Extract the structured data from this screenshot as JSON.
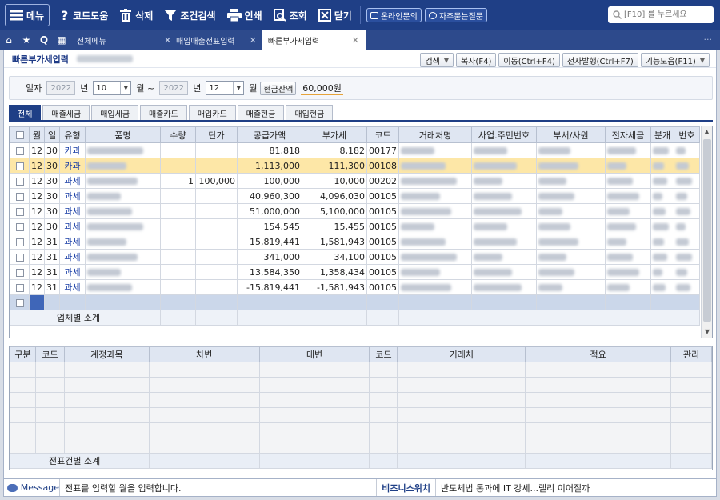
{
  "toolbar": {
    "menu": "메뉴",
    "help": "코드도움",
    "delete": "삭제",
    "filter": "조건검색",
    "print": "인쇄",
    "query": "조회",
    "close": "닫기",
    "online": "온라인문의",
    "faq": "자주묻는질문",
    "search_placeholder": "[F10] 를 누르세요"
  },
  "tabs": {
    "all_menu": "전체메뉴",
    "tab1": "매입매출전표입력",
    "tab2": "빠른부가세입력"
  },
  "page": {
    "title": "빠른부가세입력",
    "buttons": {
      "search": "검색",
      "copy": "복사(F4)",
      "move": "이동(Ctrl+F4)",
      "einvoice": "전자발행(Ctrl+F7)",
      "features": "기능모음(F11)"
    }
  },
  "filter": {
    "date_label": "일자",
    "year_from": "2022",
    "year_unit": "년",
    "month_from": "10",
    "month_unit": "월 ~",
    "year_to": "2022",
    "month_to": "12",
    "month_unit2": "월",
    "cash_button": "현금잔액",
    "cash_value": "60,000원"
  },
  "subtabs": [
    "전체",
    "매출세금",
    "매입세금",
    "매출카드",
    "매입카드",
    "매출현금",
    "매입현금"
  ],
  "grid1": {
    "headers": [
      "",
      "월",
      "일",
      "유형",
      "품명",
      "수량",
      "단가",
      "공급가액",
      "부가세",
      "코드",
      "거래처명",
      "사업.주민번호",
      "부서/사원",
      "전자세금",
      "분개",
      "번호"
    ],
    "rows": [
      {
        "m": "12",
        "d": "30",
        "type": "카과",
        "qty": "",
        "price": "",
        "supply": "81,818",
        "vat": "8,182",
        "code": "00177"
      },
      {
        "m": "12",
        "d": "30",
        "type": "카과",
        "qty": "",
        "price": "",
        "supply": "1,113,000",
        "vat": "111,300",
        "code": "00108"
      },
      {
        "m": "12",
        "d": "30",
        "type": "과세",
        "qty": "1",
        "price": "100,000",
        "supply": "100,000",
        "vat": "10,000",
        "code": "00202"
      },
      {
        "m": "12",
        "d": "30",
        "type": "과세",
        "qty": "",
        "price": "",
        "supply": "40,960,300",
        "vat": "4,096,030",
        "code": "00105"
      },
      {
        "m": "12",
        "d": "30",
        "type": "과세",
        "qty": "",
        "price": "",
        "supply": "51,000,000",
        "vat": "5,100,000",
        "code": "00105"
      },
      {
        "m": "12",
        "d": "30",
        "type": "과세",
        "qty": "",
        "price": "",
        "supply": "154,545",
        "vat": "15,455",
        "code": "00105"
      },
      {
        "m": "12",
        "d": "31",
        "type": "과세",
        "qty": "",
        "price": "",
        "supply": "15,819,441",
        "vat": "1,581,943",
        "code": "00105"
      },
      {
        "m": "12",
        "d": "31",
        "type": "과세",
        "qty": "",
        "price": "",
        "supply": "341,000",
        "vat": "34,100",
        "code": "00105"
      },
      {
        "m": "12",
        "d": "31",
        "type": "과세",
        "qty": "",
        "price": "",
        "supply": "13,584,350",
        "vat": "1,358,434",
        "code": "00105"
      },
      {
        "m": "12",
        "d": "31",
        "type": "과세",
        "qty": "",
        "price": "",
        "supply": "-15,819,441",
        "vat": "-1,581,943",
        "code": "00105"
      }
    ],
    "subtotal_label": "업체별 소계"
  },
  "grid2": {
    "headers": [
      "구분",
      "코드",
      "계정과목",
      "차변",
      "대변",
      "코드",
      "거래처",
      "적요",
      "관리"
    ],
    "subtotal_label": "전표건별 소계"
  },
  "status": {
    "message_label": "Message",
    "message": "전표를 입력할 월을 입력합니다.",
    "biz_label": "비즈니스위치",
    "news": "반도체법 통과에 IT 강세...랠리 이어질까"
  },
  "colors": {
    "toolbar": "#1f3f86",
    "highlight_row": "#fde7a7",
    "header_cell": "#dfe6f2"
  }
}
